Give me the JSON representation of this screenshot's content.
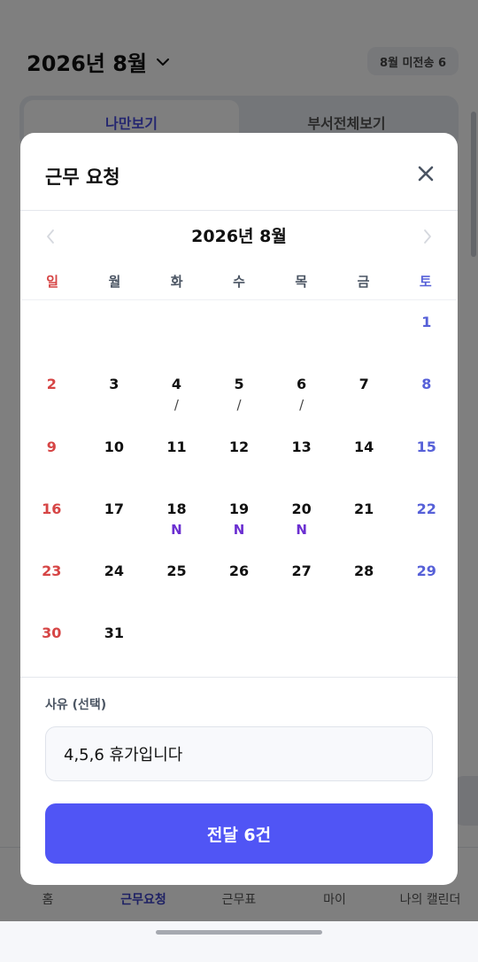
{
  "background": {
    "title": "2026년 8월",
    "badge": "8월 미전송 6",
    "tabs": [
      "나만보기",
      "부서전체보기"
    ],
    "nav": [
      "홈",
      "근무요청",
      "근무표",
      "마이",
      "나의 캘린더"
    ]
  },
  "modal": {
    "title": "근무 요청",
    "month_title": "2026년 8월",
    "weekdays": [
      "일",
      "월",
      "화",
      "수",
      "목",
      "금",
      "토"
    ],
    "weeks": [
      [
        {
          "d": "",
          "m": ""
        },
        {
          "d": "",
          "m": ""
        },
        {
          "d": "",
          "m": ""
        },
        {
          "d": "",
          "m": ""
        },
        {
          "d": "",
          "m": ""
        },
        {
          "d": "",
          "m": ""
        },
        {
          "d": "1",
          "m": ""
        }
      ],
      [
        {
          "d": "2",
          "m": ""
        },
        {
          "d": "3",
          "m": ""
        },
        {
          "d": "4",
          "m": "/"
        },
        {
          "d": "5",
          "m": "/"
        },
        {
          "d": "6",
          "m": "/"
        },
        {
          "d": "7",
          "m": ""
        },
        {
          "d": "8",
          "m": ""
        }
      ],
      [
        {
          "d": "9",
          "m": ""
        },
        {
          "d": "10",
          "m": ""
        },
        {
          "d": "11",
          "m": ""
        },
        {
          "d": "12",
          "m": ""
        },
        {
          "d": "13",
          "m": ""
        },
        {
          "d": "14",
          "m": ""
        },
        {
          "d": "15",
          "m": ""
        }
      ],
      [
        {
          "d": "16",
          "m": ""
        },
        {
          "d": "17",
          "m": ""
        },
        {
          "d": "18",
          "m": "N"
        },
        {
          "d": "19",
          "m": "N"
        },
        {
          "d": "20",
          "m": "N"
        },
        {
          "d": "21",
          "m": ""
        },
        {
          "d": "22",
          "m": ""
        }
      ],
      [
        {
          "d": "23",
          "m": ""
        },
        {
          "d": "24",
          "m": ""
        },
        {
          "d": "25",
          "m": ""
        },
        {
          "d": "26",
          "m": ""
        },
        {
          "d": "27",
          "m": ""
        },
        {
          "d": "28",
          "m": ""
        },
        {
          "d": "29",
          "m": ""
        }
      ],
      [
        {
          "d": "30",
          "m": ""
        },
        {
          "d": "31",
          "m": ""
        },
        {
          "d": "",
          "m": ""
        },
        {
          "d": "",
          "m": ""
        },
        {
          "d": "",
          "m": ""
        },
        {
          "d": "",
          "m": ""
        },
        {
          "d": "",
          "m": ""
        }
      ]
    ],
    "reason_label": "사유 (선택)",
    "reason_value": "4,5,6 휴가입니다",
    "submit_label": "전달 6건"
  },
  "colors": {
    "accent": "#5055f5",
    "sunday": "#d64545",
    "saturday": "#5660d8",
    "night_shift": "#6b2fd1"
  }
}
